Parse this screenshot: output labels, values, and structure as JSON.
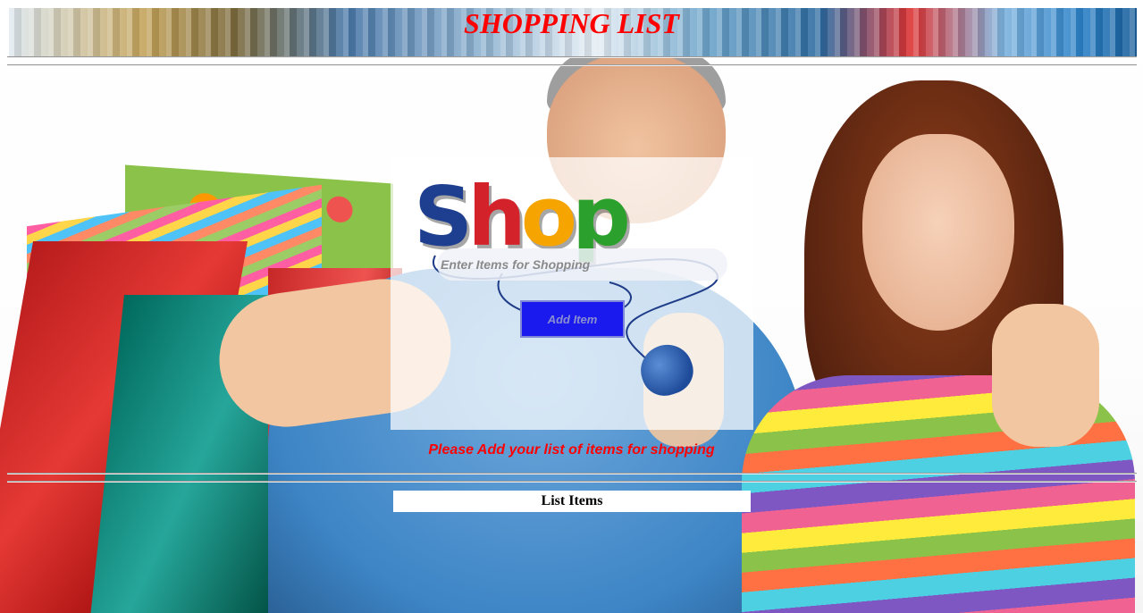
{
  "header": {
    "title": "SHOPPING LIST"
  },
  "form": {
    "logo_text": [
      "S",
      "h",
      "o",
      "p"
    ],
    "item_input": {
      "value": "",
      "placeholder": "Enter Items for Shopping"
    },
    "add_button_label": "Add Item",
    "hint": "Please Add your list of items for shopping"
  },
  "list": {
    "header": "List Items",
    "items": []
  },
  "colors": {
    "title": "#ff0000",
    "hint": "#ff0000",
    "add_button_bg": "#1a1aee",
    "panel_bg": "rgba(255,255,255,0.72)"
  }
}
